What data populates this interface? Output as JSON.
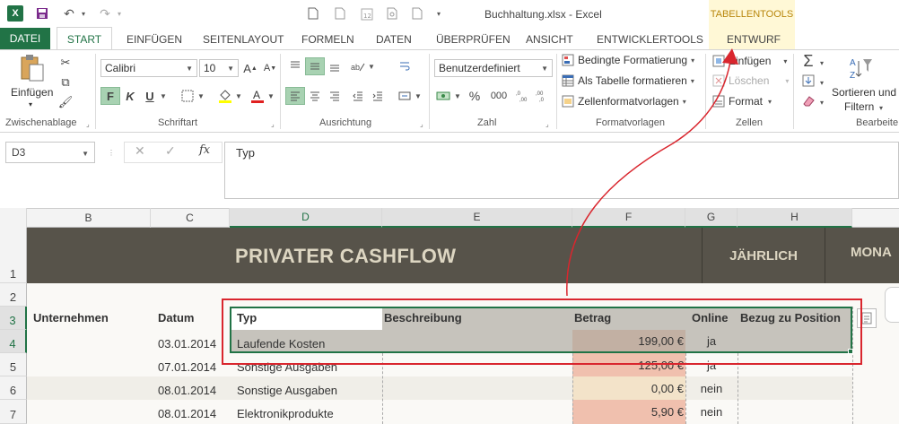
{
  "window": {
    "title": "Buchhaltung.xlsx - Excel",
    "app_icon": "X"
  },
  "contextual": {
    "label": "TABELLENTOOLS",
    "tab": "ENTWURF"
  },
  "tabs": [
    "DATEI",
    "START",
    "EINFÜGEN",
    "SEITENLAYOUT",
    "FORMELN",
    "DATEN",
    "ÜBERPRÜFEN",
    "ANSICHT",
    "ENTWICKLERTOOLS"
  ],
  "ribbon": {
    "paste_label": "Einfügen",
    "font_name": "Calibri",
    "font_size": "10",
    "bold": "F",
    "italic": "K",
    "underline": "U",
    "number_format": "Benutzerdefiniert",
    "percent": "%",
    "thousands": "000",
    "conditional_formatting": "Bedingte Formatierung",
    "format_as_table": "Als Tabelle formatieren",
    "cell_styles": "Zellenformatvorlagen",
    "insert_cells": "Einfügen",
    "delete_cells": "Löschen",
    "format_cells": "Format",
    "sort_filter_line1": "Sortieren und",
    "sort_filter_line2": "Filtern",
    "groups": {
      "clipboard": "Zwischenablage",
      "font": "Schriftart",
      "alignment": "Ausrichtung",
      "number": "Zahl",
      "styles": "Formatvorlagen",
      "cells": "Zellen",
      "editing": "Bearbeite"
    }
  },
  "formula_bar": {
    "name_box": "D3",
    "formula": "Typ",
    "fx": "fx"
  },
  "columns": [
    "B",
    "C",
    "D",
    "E",
    "F",
    "G",
    "H"
  ],
  "rows": [
    "1",
    "2",
    "3",
    "4",
    "5",
    "6",
    "7"
  ],
  "sheet": {
    "banner_title": "PRIVATER CASHFLOW",
    "btn_yearly": "JÄHRLICH",
    "btn_monthly": "MONA",
    "headers": {
      "company": "Unternehmen",
      "date": "Datum",
      "type": "Typ",
      "description": "Beschreibung",
      "amount": "Betrag",
      "online": "Online",
      "ref": "Bezug zu Position"
    },
    "data_rows": [
      {
        "date": "03.01.2014",
        "type": "Laufende Kosten",
        "amount": "199,00 €",
        "online": "ja"
      },
      {
        "date": "07.01.2014",
        "type": "Sonstige Ausgaben",
        "amount": "125,00 €",
        "online": "ja"
      },
      {
        "date": "08.01.2014",
        "type": "Sonstige Ausgaben",
        "amount": "0,00 €",
        "online": "nein"
      },
      {
        "date": "08.01.2014",
        "type": "Elektronikprodukte",
        "amount": "5,90 €",
        "online": "nein"
      }
    ]
  },
  "colors": {
    "excel_green": "#217346",
    "banner": "#57534a",
    "annotation_red": "#d9262e"
  }
}
